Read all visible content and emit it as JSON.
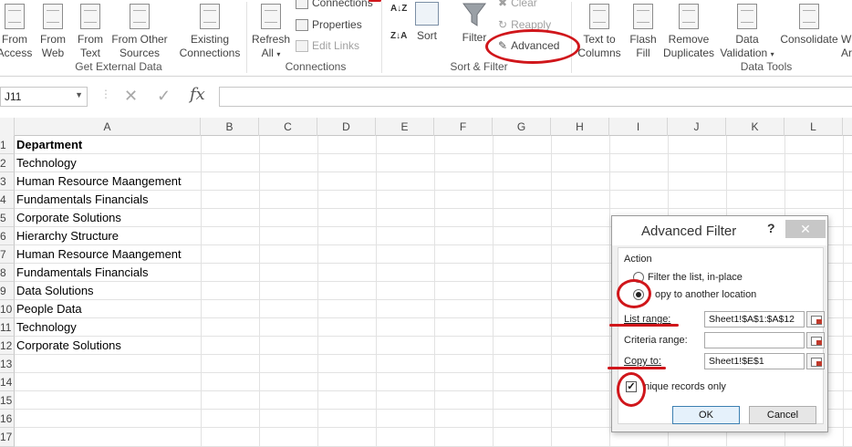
{
  "ribbon": {
    "get_external": {
      "from_access": [
        "From",
        "Access"
      ],
      "from_web": [
        "From",
        "Web"
      ],
      "from_text": [
        "From",
        "Text"
      ],
      "from_other": [
        "From Other",
        "Sources"
      ],
      "existing": [
        "Existing",
        "Connections"
      ],
      "group_label": "Get External Data"
    },
    "connections": {
      "refresh_all": [
        "Refresh",
        "All"
      ],
      "connections": "Connections",
      "properties": "Properties",
      "edit_links": "Edit Links",
      "group_label": "Connections"
    },
    "sort_filter": {
      "sort": "Sort",
      "filter": "Filter",
      "clear": "Clear",
      "reapply": "Reapply",
      "advanced": "Advanced",
      "group_label": "Sort & Filter"
    },
    "data_tools": {
      "text_to_columns": [
        "Text to",
        "Columns"
      ],
      "flash_fill": [
        "Flash",
        "Fill"
      ],
      "remove_duplicates": [
        "Remove",
        "Duplicates"
      ],
      "data_validation": [
        "Data",
        "Validation"
      ],
      "consolidate": "Consolidate",
      "what_if": [
        "W",
        "Ar"
      ],
      "group_label": "Data Tools"
    }
  },
  "formula_bar": {
    "name_box": "J11",
    "fx": "fx",
    "value": ""
  },
  "sheet": {
    "columns": [
      "A",
      "B",
      "C",
      "D",
      "E",
      "F",
      "G",
      "H",
      "I",
      "J",
      "K",
      "L"
    ],
    "rows": [
      "1",
      "2",
      "3",
      "4",
      "5",
      "6",
      "7",
      "8",
      "9",
      "10",
      "11",
      "12",
      "13",
      "14",
      "15",
      "16",
      "17"
    ],
    "cells_a": [
      "Department",
      "Technology",
      "Human Resource Maangement",
      "Fundamentals Financials",
      "Corporate Solutions",
      "Hierarchy Structure",
      "Human Resource Maangement",
      "Fundamentals Financials",
      "Data Solutions",
      "People Data",
      "Technology",
      "Corporate Solutions"
    ]
  },
  "dialog": {
    "title": "Advanced Filter",
    "help": "?",
    "close": "✕",
    "action_label": "Action",
    "option_inplace": "Filter the list, in-place",
    "option_copy": "opy to another location",
    "list_range_label": "List range:",
    "list_range_value": "Sheet1!$A$1:$A$12",
    "criteria_range_label": "Criteria range:",
    "criteria_range_value": "",
    "copy_to_label": "Copy to:",
    "copy_to_value": "Sheet1!$E$1",
    "unique_label": "nique records only",
    "unique_checked": true,
    "ok": "OK",
    "cancel": "Cancel"
  },
  "colors": {
    "annotation_red": "#d0161b",
    "ok_border": "#3c7fb1"
  }
}
